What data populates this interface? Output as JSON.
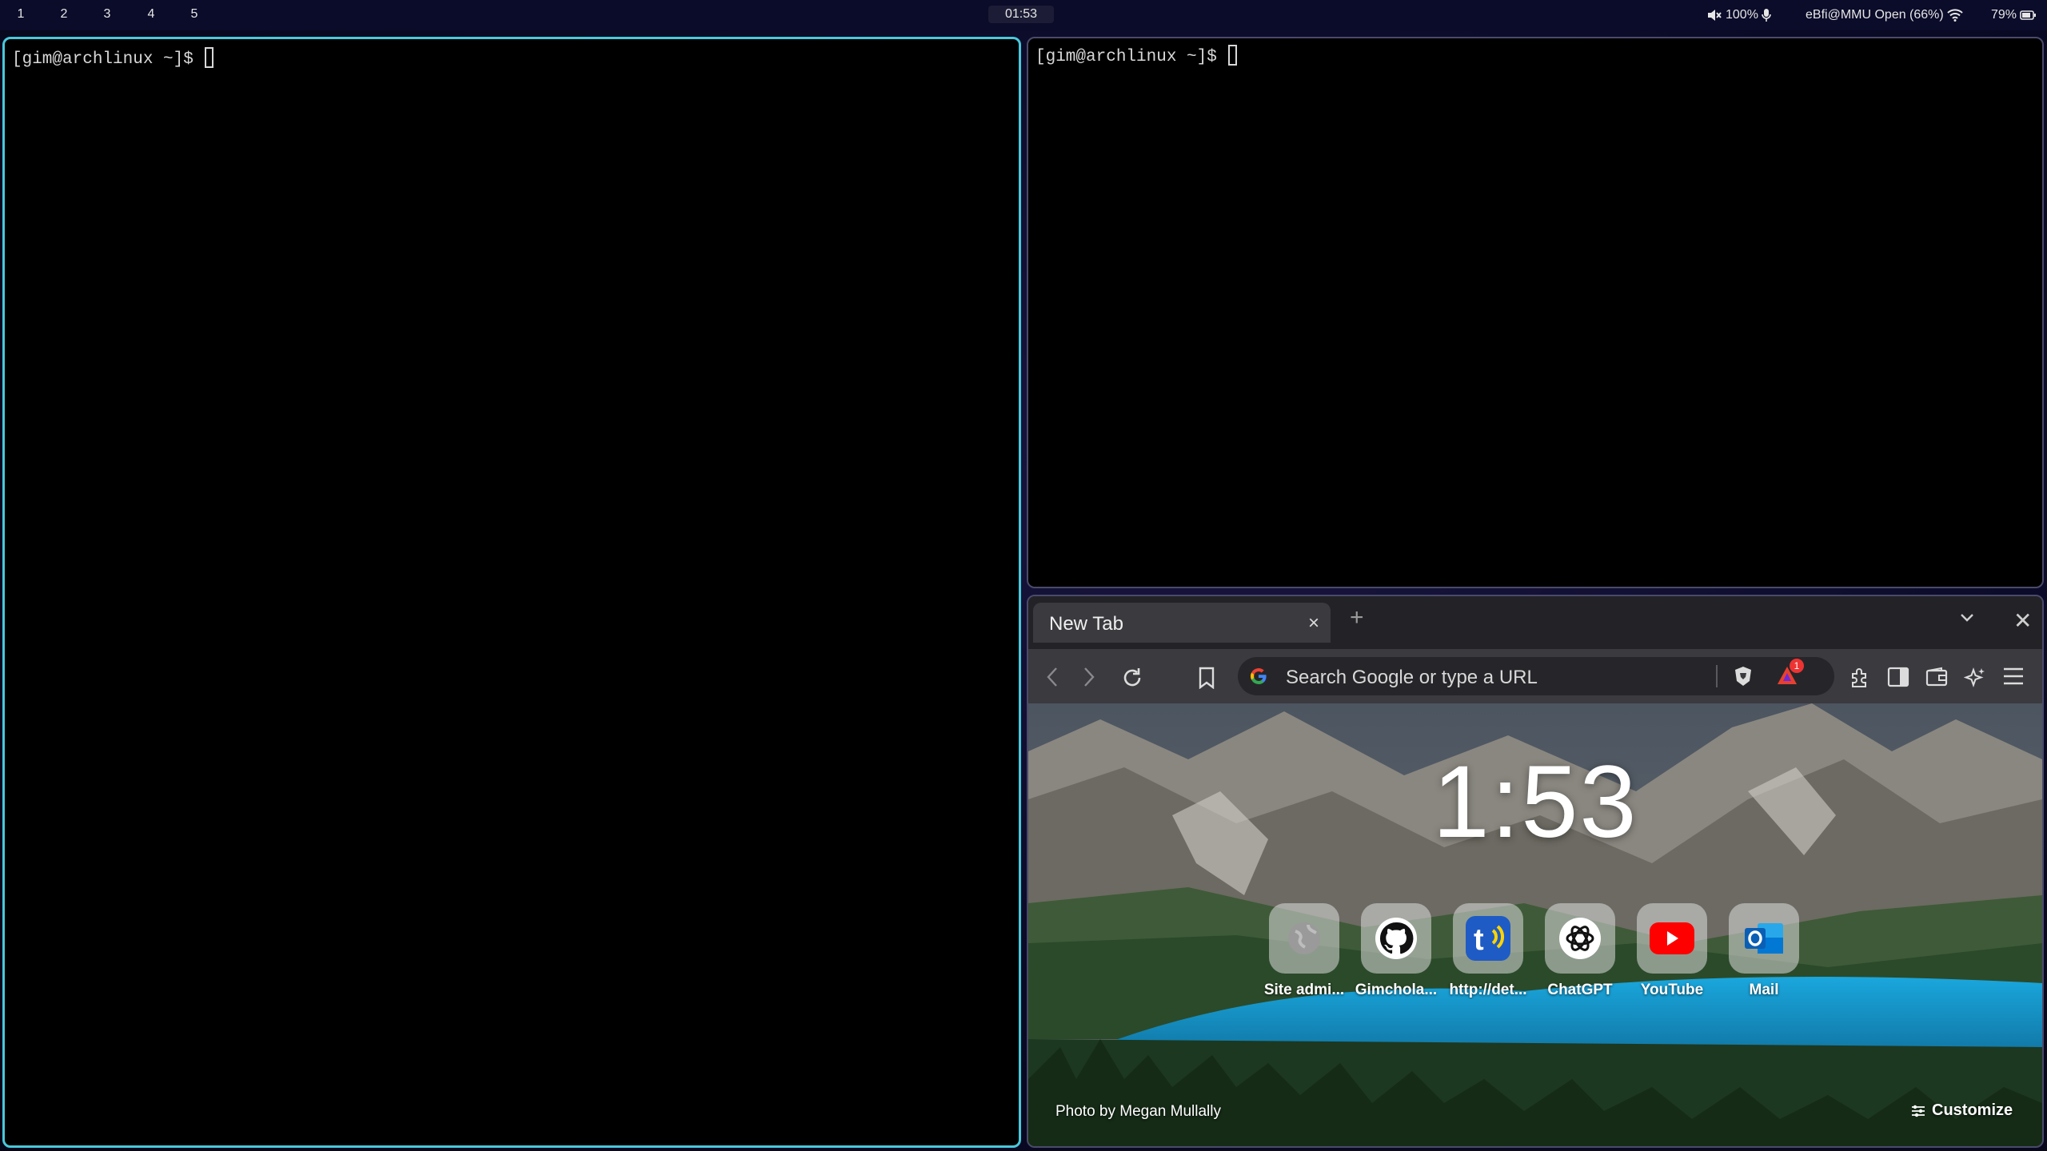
{
  "topbar": {
    "workspaces": [
      "1",
      "2",
      "3",
      "4",
      "5"
    ],
    "clock": "01:53",
    "volume": "100%",
    "network": "eBfi@MMU Open (66%)",
    "battery": "79%"
  },
  "terminals": {
    "left": {
      "prompt": "[gim@archlinux ~]$ "
    },
    "right": {
      "prompt": "[gim@archlinux ~]$ "
    }
  },
  "browser": {
    "tab_title": "New Tab",
    "tab_close": "×",
    "new_tab": "+",
    "window_close": "✕",
    "search_placeholder": "Search Google or type a URL",
    "rewards_badge": "1",
    "ntp": {
      "clock": "1:53",
      "tiles": [
        {
          "label": "Site admi...",
          "icon": "globe-icon"
        },
        {
          "label": "Gimchola...",
          "icon": "github-icon"
        },
        {
          "label": "http://det...",
          "icon": "t-signal-icon"
        },
        {
          "label": "ChatGPT",
          "icon": "chatgpt-icon"
        },
        {
          "label": "YouTube",
          "icon": "youtube-icon"
        },
        {
          "label": "Mail",
          "icon": "outlook-icon"
        }
      ],
      "photo_credit": "Photo by Megan Mullally",
      "customize": "Customize"
    }
  },
  "colors": {
    "active_border": "#4ac8d9",
    "inactive_border": "#4a4a6a",
    "topbar_bg": "#0b0b2a"
  }
}
